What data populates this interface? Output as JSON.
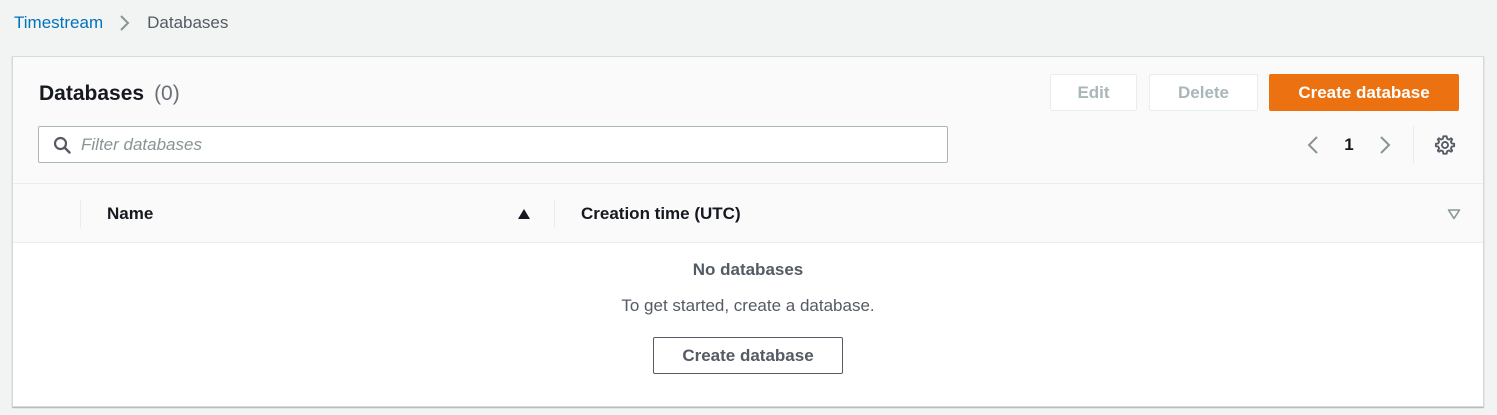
{
  "breadcrumb": {
    "items": [
      {
        "label": "Timestream"
      },
      {
        "label": "Databases"
      }
    ]
  },
  "header": {
    "title": "Databases",
    "count": "(0)",
    "edit_label": "Edit",
    "delete_label": "Delete",
    "create_label": "Create database"
  },
  "filter": {
    "placeholder": "Filter databases",
    "value": ""
  },
  "pagination": {
    "current_page": "1"
  },
  "table": {
    "columns": [
      {
        "label": "Name",
        "sort": "ascending"
      },
      {
        "label": "Creation time (UTC)",
        "sort": "none"
      }
    ],
    "rows": []
  },
  "empty_state": {
    "title": "No databases",
    "description": "To get started, create a database.",
    "button_label": "Create database"
  },
  "colors": {
    "link": "#0073bb",
    "primary": "#ec7211",
    "text": "#16191f",
    "muted": "#545b64",
    "disabled": "#aab7b8"
  }
}
